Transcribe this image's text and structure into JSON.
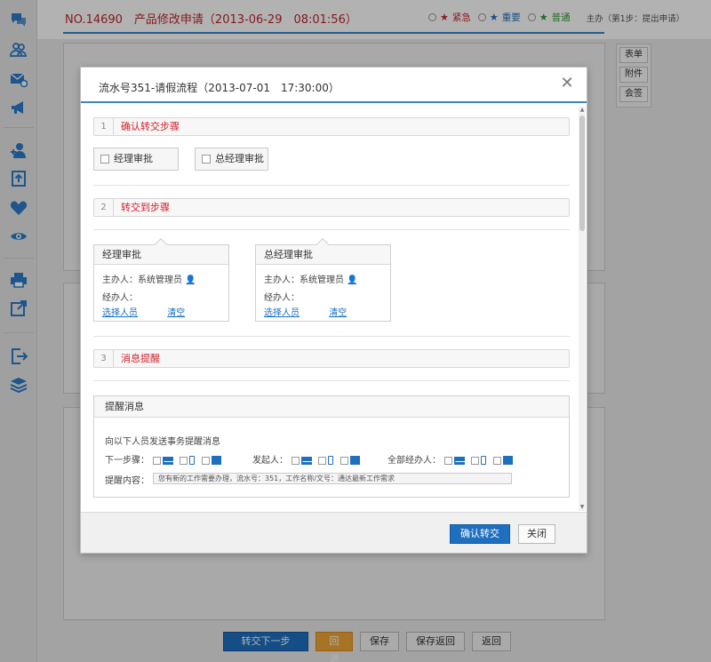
{
  "page": {
    "title": "NO.14690　产品修改申请（2013-06-29　08:01:56）",
    "priority": {
      "urgent": "紧急",
      "important": "重要",
      "normal": "普通"
    },
    "step_info": "主办（第1步：提出申请）",
    "side_buttons": [
      "表单",
      "附件",
      "会签"
    ],
    "bottom_buttons": [
      "转交下一步",
      "回退",
      "保存",
      "保存返回",
      "返回"
    ]
  },
  "sidebar": {
    "icons": [
      "chat-icon",
      "users-icon",
      "mail-icon",
      "megaphone-icon",
      "user-add-icon",
      "upload-icon",
      "heart-icon",
      "eye-icon",
      "print-icon",
      "export-icon",
      "logout-icon",
      "layers-icon"
    ]
  },
  "modal": {
    "title": "流水号351-请假流程（2013-07-01　17:30:00）",
    "sections": [
      {
        "num": "1",
        "title": "确认转交步骤"
      },
      {
        "num": "2",
        "title": "转交到步骤"
      },
      {
        "num": "3",
        "title": "消息提醒"
      }
    ],
    "step_options": [
      "经理审批",
      "总经理审批"
    ],
    "cards": [
      {
        "title": "经理审批",
        "host_label": "主办人：",
        "host_value": "系统管理员",
        "handlers_label": "经办人：",
        "select": "选择人员",
        "clear": "清空"
      },
      {
        "title": "总经理审批",
        "host_label": "主办人：",
        "host_value": "系统管理员",
        "handlers_label": "经办人：",
        "select": "选择人员",
        "clear": "清空"
      }
    ],
    "reminder": {
      "box_title": "提醒消息",
      "intro": "向以下人员发送事务提醒消息",
      "next_step": "下一步骤：",
      "initiator": "发起人：",
      "all_handlers": "全部经办人：",
      "content_label": "提醒内容：",
      "content_value": "您有新的工作需要办理，流水号：351，工作名称/文号：通达最新工作需求"
    },
    "buttons": {
      "confirm": "确认转交",
      "close": "关闭"
    }
  },
  "colors": {
    "accent": "#1f6fc0",
    "title_red": "#c0262d",
    "section_red": "#d0202a",
    "orange": "#f0a535"
  }
}
